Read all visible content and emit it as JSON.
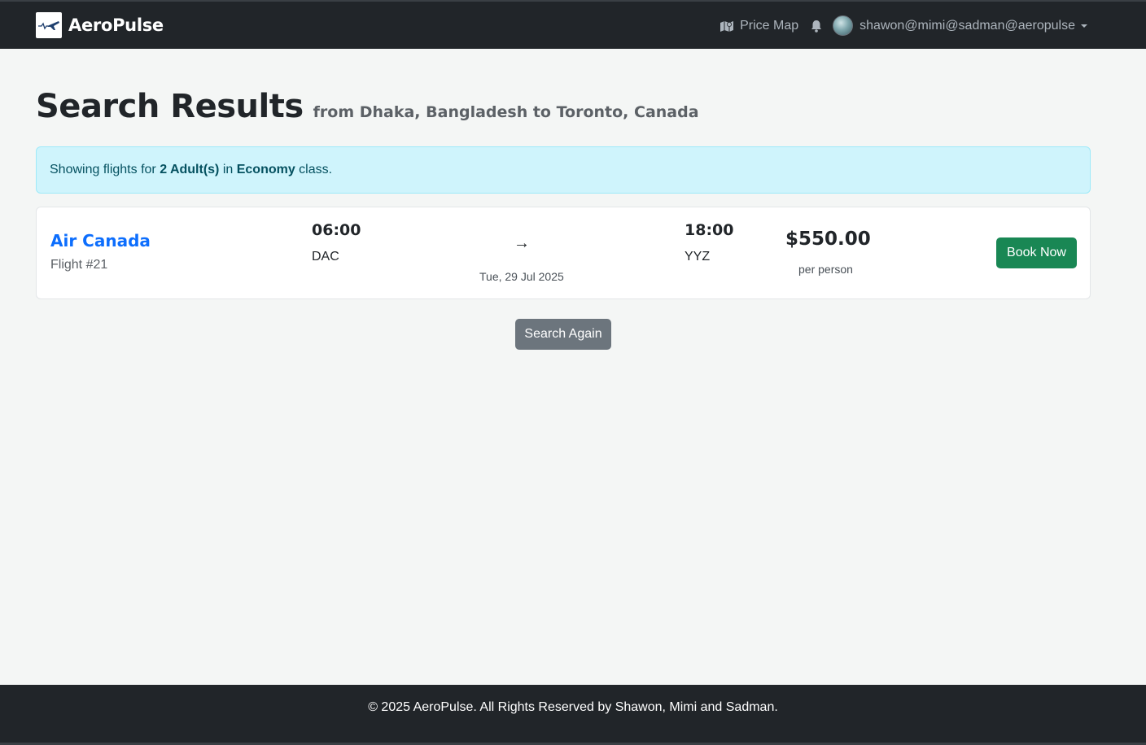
{
  "navbar": {
    "brand": "AeroPulse",
    "price_map_label": "Price Map",
    "user_label": "shawon@mimi@sadman@aeropulse"
  },
  "header": {
    "title": "Search Results",
    "subtitle": "from Dhaka, Bangladesh to Toronto, Canada"
  },
  "alert": {
    "prefix": "Showing flights for ",
    "passengers": "2 Adult(s)",
    "middle": " in ",
    "cabin_class": "Economy",
    "suffix": " class."
  },
  "results": [
    {
      "airline": "Air Canada",
      "flight_number": "Flight #21",
      "departure_time": "06:00",
      "departure_code": "DAC",
      "arrow": "→",
      "date": "Tue, 29 Jul 2025",
      "arrival_time": "18:00",
      "arrival_code": "YYZ",
      "price": "$550.00",
      "price_unit": "per person",
      "book_label": "Book Now"
    }
  ],
  "actions": {
    "search_again_label": "Search Again"
  },
  "footer": {
    "text": "© 2025 AeroPulse. All Rights Reserved by Shawon, Mimi and Sadman."
  },
  "colors": {
    "navbar_bg": "#212529",
    "link_blue": "#0d6efd",
    "success_green": "#198754",
    "secondary_gray": "#6c757d",
    "alert_bg": "#cff4fc"
  },
  "icons": [
    "plane-logo-icon",
    "map-icon",
    "bell-icon",
    "avatar",
    "caret-down-icon"
  ]
}
